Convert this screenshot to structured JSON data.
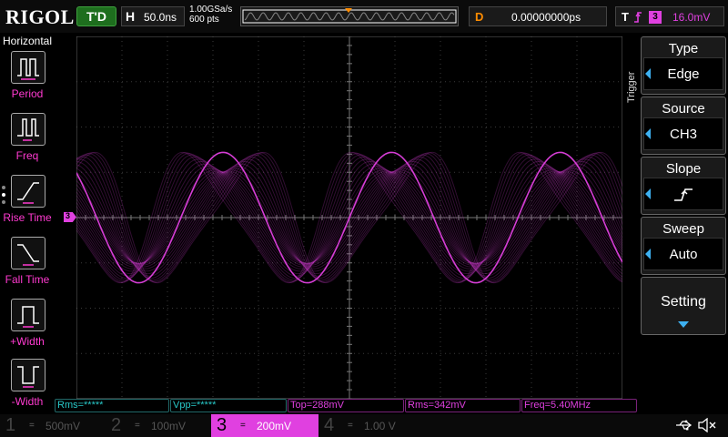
{
  "header": {
    "brand": "RIGOL",
    "run_status": "T'D",
    "horizontal_label": "H",
    "timebase": "50.0ns",
    "sample_rate": "1.00GSa/s",
    "memory_depth": "600 pts",
    "delay_label": "D",
    "delay_value": "0.00000000ps",
    "trigger_label": "T",
    "trigger_source_badge": "3",
    "trigger_level": "16.0mV"
  },
  "left_panel": {
    "title": "Horizontal",
    "items": [
      {
        "label": "Period",
        "icon": "period-icon"
      },
      {
        "label": "Freq",
        "icon": "frequency-icon"
      },
      {
        "label": "Rise Time",
        "icon": "rise-time-icon"
      },
      {
        "label": "Fall Time",
        "icon": "fall-time-icon"
      },
      {
        "label": "+Width",
        "icon": "positive-width-icon"
      },
      {
        "label": "-Width",
        "icon": "negative-width-icon"
      }
    ]
  },
  "markers": {
    "trigger_position": "T",
    "channel_marker": "3"
  },
  "right_menu": {
    "title": "Trigger",
    "type": {
      "label": "Type",
      "value": "Edge"
    },
    "source": {
      "label": "Source",
      "value": "CH3"
    },
    "slope": {
      "label": "Slope",
      "icon": "rising-edge-icon"
    },
    "sweep": {
      "label": "Sweep",
      "value": "Auto"
    },
    "setting": {
      "label": "Setting"
    }
  },
  "measurements": [
    {
      "text": "Rms=*****",
      "channel": "2"
    },
    {
      "text": "Vpp=*****",
      "channel": "2"
    },
    {
      "text": "Top=288mV",
      "channel": "3"
    },
    {
      "text": "Rms=342mV",
      "channel": "3"
    },
    {
      "text": "Freq=5.40MHz",
      "channel": "3"
    }
  ],
  "channels": [
    {
      "number": "1",
      "coupling": "=",
      "scale": "500mV",
      "active": false
    },
    {
      "number": "2",
      "coupling": "=",
      "scale": "100mV",
      "active": false
    },
    {
      "number": "3",
      "coupling": "=",
      "scale": "200mV",
      "active": true
    },
    {
      "number": "4",
      "coupling": "=",
      "scale": "1.00 V",
      "active": false
    }
  ],
  "colors": {
    "ch3": "#e040e0",
    "ch2": "#28c8c8",
    "trigger": "#ff8c00",
    "run_status": "#1e6e1e",
    "accent_arrow": "#3db0f0"
  },
  "waveform": {
    "channel": "3",
    "frequency_mhz": 5.4,
    "vertical_scale_mv_per_div": 200,
    "timebase_ns_per_div": 50,
    "amplitude_mv": 288,
    "trace_envelope": "persistence"
  }
}
